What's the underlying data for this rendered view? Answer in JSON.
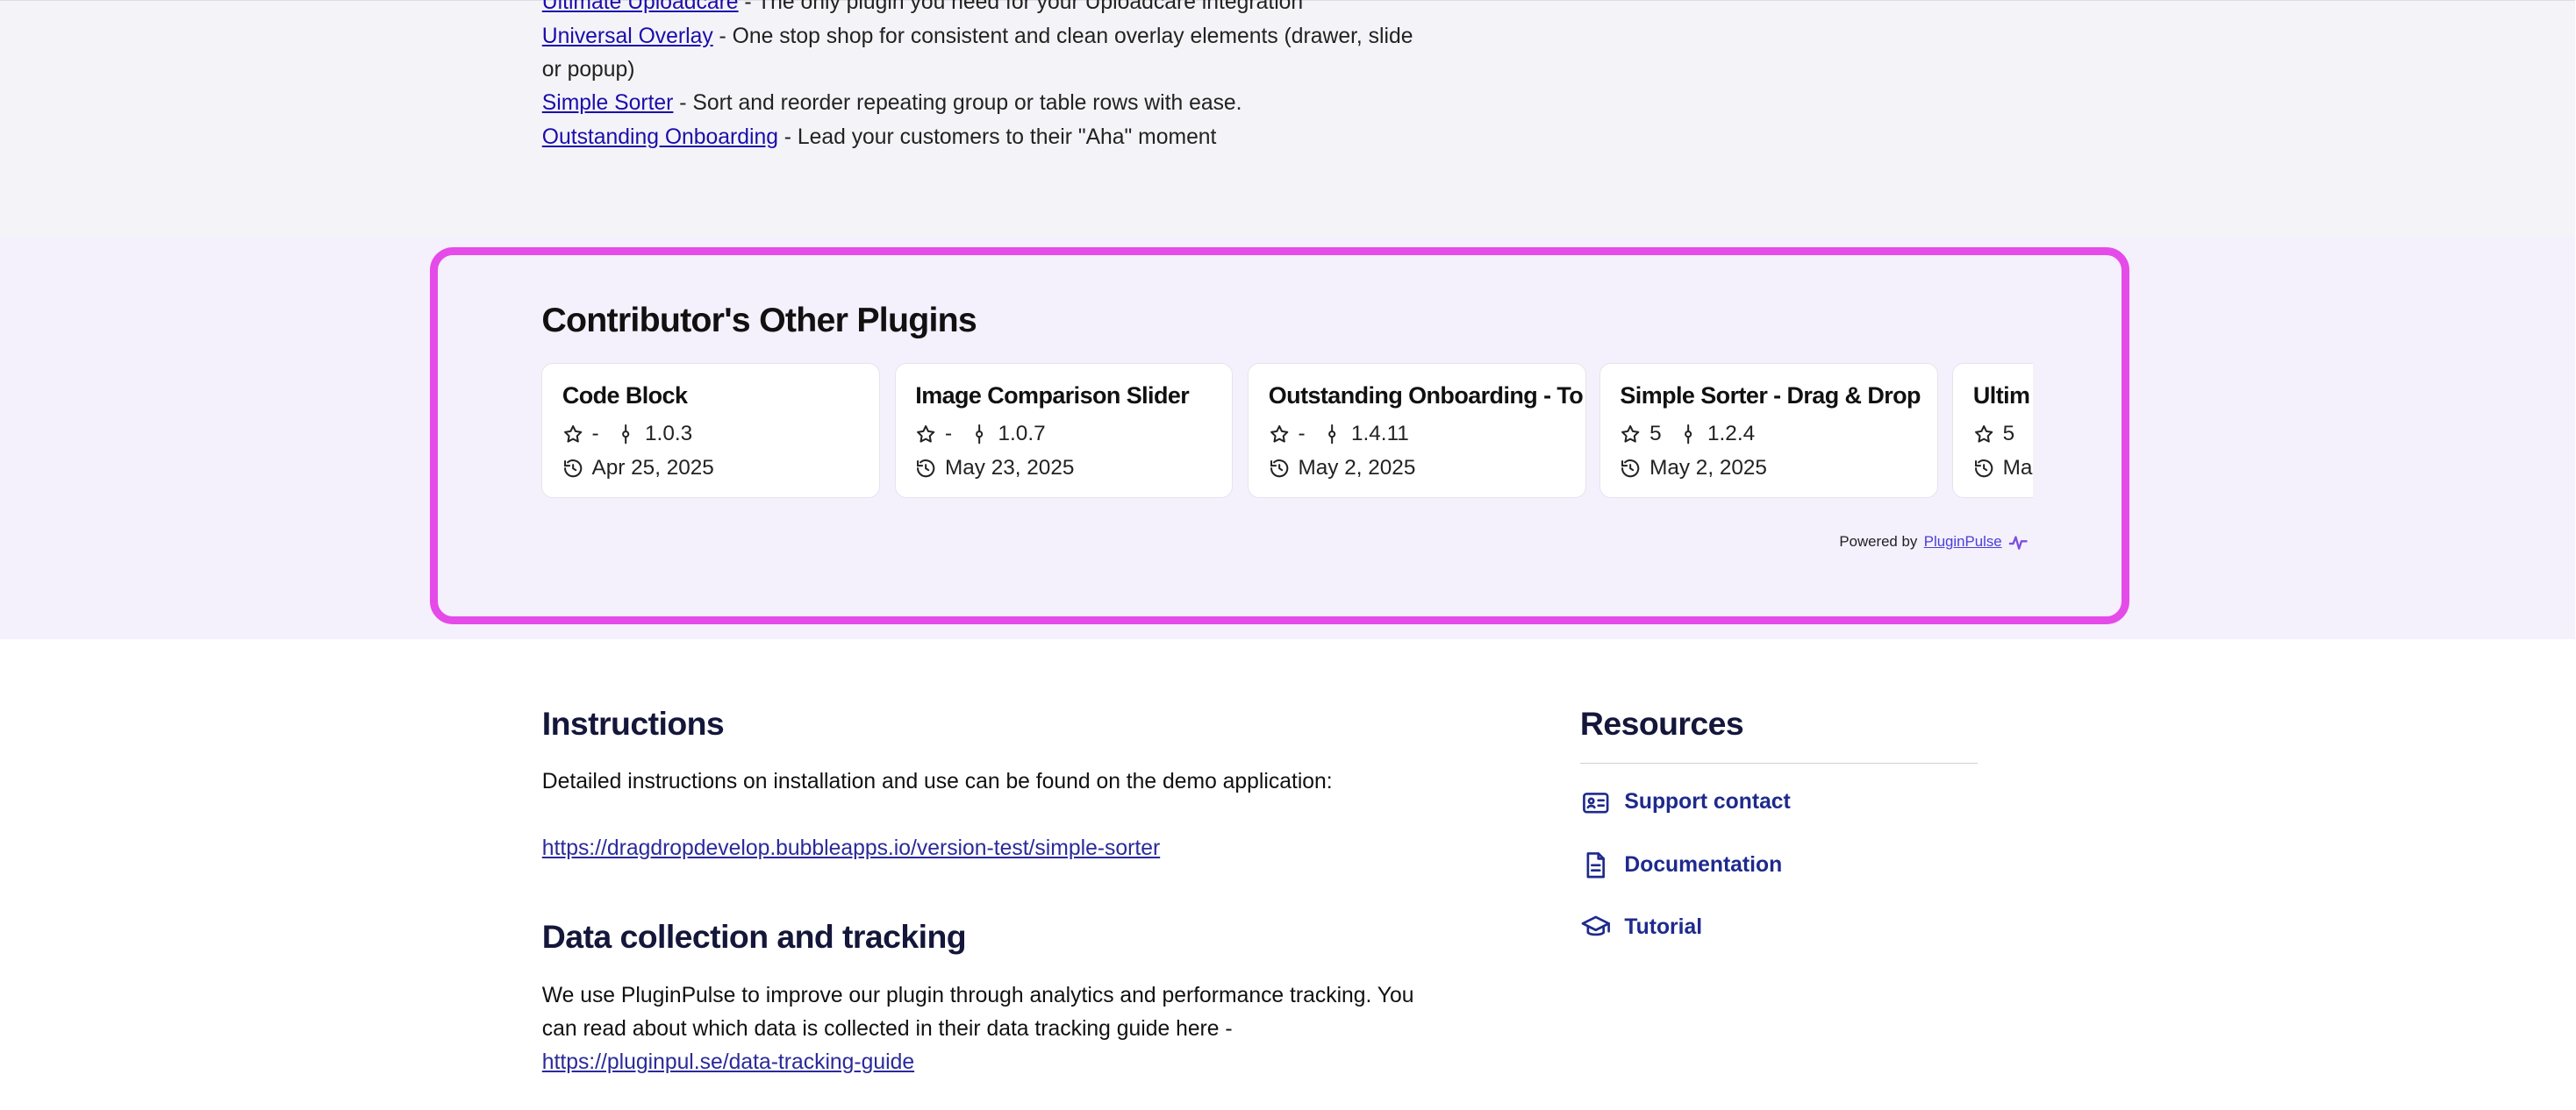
{
  "plugin_list": [
    {
      "link": "Ultimate Uploadcare",
      "desc": " - The only plugin you need for your Uploadcare integration"
    },
    {
      "link": "Universal Overlay",
      "desc": " - One stop shop for consistent and clean overlay elements (drawer, slide or popup)"
    },
    {
      "link": "Simple Sorter",
      "desc": " - Sort and reorder repeating group or table rows with ease."
    },
    {
      "link": "Outstanding Onboarding",
      "desc": " - Lead your customers to their \"Aha\" moment"
    }
  ],
  "other_plugins": {
    "title": "Contributor's Other Plugins",
    "cards": [
      {
        "name": "Code Block",
        "rating": "-",
        "version": "1.0.3",
        "date": "Apr 25, 2025"
      },
      {
        "name": "Image Comparison Slider",
        "rating": "-",
        "version": "1.0.7",
        "date": "May 23, 2025"
      },
      {
        "name": "Outstanding Onboarding - To",
        "rating": "-",
        "version": "1.4.11",
        "date": "May 2, 2025"
      },
      {
        "name": "Simple Sorter - Drag & Drop",
        "rating": "5",
        "version": "1.2.4",
        "date": "May 2, 2025"
      },
      {
        "name": "Ultim",
        "rating": "5",
        "version": "",
        "date": "Ma"
      }
    ],
    "powered_by": "Powered by",
    "powered_link": "PluginPulse",
    "accent_color": "#e54be8"
  },
  "instructions": {
    "title": "Instructions",
    "text": "Detailed instructions on installation and use can be found on the demo application:",
    "link": "https://dragdropdevelop.bubbleapps.io/version-test/simple-sorter"
  },
  "data_collection": {
    "title": "Data collection and tracking",
    "text": "We use PluginPulse to improve our plugin through analytics and performance tracking. You can read about which data is collected in their data tracking guide here - ",
    "link": "https://pluginpul.se/data-tracking-guide"
  },
  "resources": {
    "title": "Resources",
    "items": [
      {
        "label": "Support contact",
        "icon": "contact-card-icon"
      },
      {
        "label": "Documentation",
        "icon": "document-icon"
      },
      {
        "label": "Tutorial",
        "icon": "graduation-cap-icon"
      }
    ]
  }
}
